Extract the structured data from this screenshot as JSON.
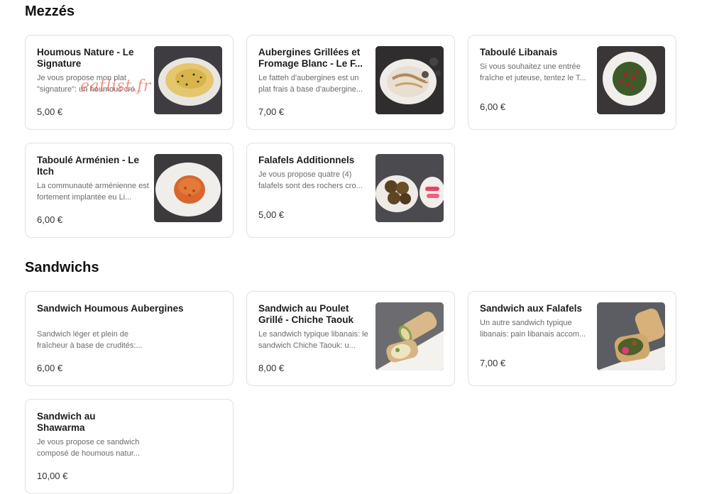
{
  "sections": [
    {
      "title": "Mezzés",
      "items": [
        {
          "name": "Houmous Nature - Le Signature",
          "desc": "Je vous propose mon plat \"signature\": un houmous cré...",
          "price": "5,00 €"
        },
        {
          "name": "Aubergines Grillées et Fromage Blanc - Le F...",
          "desc": "Le fatteh d'aubergines est un plat frais à base d'aubergine...",
          "price": "7,00 €"
        },
        {
          "name": "Taboulé Libanais",
          "desc": "Si vous souhaitez une entrée fraîche et juteuse, tentez le T...",
          "price": "6,00 €"
        },
        {
          "name": "Taboulé Arménien - Le Itch",
          "desc": "La communauté arménienne est fortement implantée eu Li...",
          "price": "6,00 €"
        },
        {
          "name": "Falafels Additionnels",
          "desc": "Je vous propose quatre (4) falafels sont des rochers cro...",
          "price": "5,00 €"
        }
      ]
    },
    {
      "title": "Sandwichs",
      "items": [
        {
          "name": "Sandwich Houmous Aubergines",
          "desc": "Sandwich léger et plein de fraîcheur à base de crudités:...",
          "price": "6,00 €"
        },
        {
          "name": "Sandwich au Poulet Grillé - Chiche Taouk",
          "desc": "Le sandwich typique libanais: le sandwich Chiche Taouk: u...",
          "price": "8,00 €"
        },
        {
          "name": "Sandwich aux Falafels",
          "desc": "Un autre sandwich typique libanais: pain libanais accom...",
          "price": "7,00 €"
        },
        {
          "name": "Sandwich au Shawarma",
          "desc": "Je vous propose ce sandwich composé de houmous natur...",
          "price": "10,00 €"
        }
      ]
    }
  ],
  "watermark": "eatlist.fr",
  "icons": {
    "houmous": "houmous-photo",
    "aubergines": "aubergines-photo",
    "taboule_libanais": "taboule-photo",
    "taboule_armenien": "itch-photo",
    "falafels": "falafels-photo",
    "chiche_taouk": "chiche-taouk-photo",
    "falafel_wrap": "falafel-wrap-photo"
  }
}
